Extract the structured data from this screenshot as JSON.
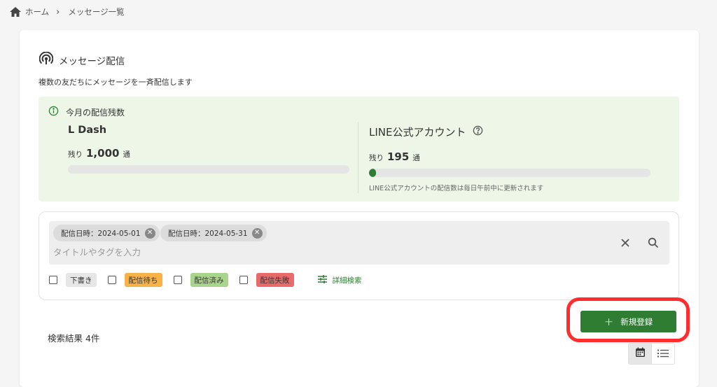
{
  "breadcrumb": {
    "home": "ホーム",
    "current": "メッセージ一覧"
  },
  "header": {
    "title": "メッセージ配信",
    "subtitle": "複数の友だちにメッセージを一斉配信します"
  },
  "quota": {
    "heading": "今月の配信残数",
    "ldash": {
      "name": "L Dash",
      "remain_label": "残り",
      "remain_value": "1,000",
      "unit": "通",
      "fill_fraction": 0
    },
    "line": {
      "name": "LINE公式アカウント",
      "remain_label": "残り",
      "remain_value": "195",
      "unit": "通",
      "fill_fraction": 0.025,
      "note": "LINE公式アカウントの配信数は毎日午前中に更新されます"
    }
  },
  "search": {
    "chips": [
      "配信日時：2024-05-01",
      "配信日時：2024-05-31"
    ],
    "placeholder": "タイトルやタグを入力",
    "filters": [
      {
        "label": "下書き",
        "color": "#e6e6e6"
      },
      {
        "label": "配信待ち",
        "color": "#f9b248"
      },
      {
        "label": "配信済み",
        "color": "#a8d58b"
      },
      {
        "label": "配信失敗",
        "color": "#e86b6b"
      }
    ],
    "advanced_label": "詳細検索"
  },
  "actions": {
    "new_label": "新規登録"
  },
  "results": {
    "label": "検索結果 4件"
  },
  "colors": {
    "accent": "#2e7d32",
    "quota_bg": "#eef6e8",
    "highlight": "#ff2d2d"
  }
}
